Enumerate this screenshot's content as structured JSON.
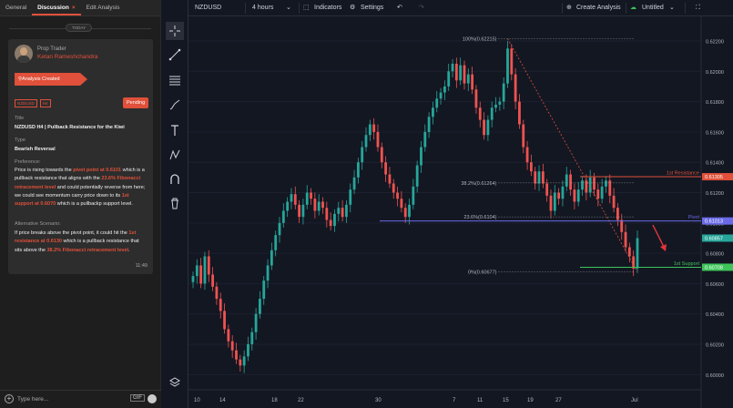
{
  "left_panel": {
    "tabs": [
      {
        "label": "General"
      },
      {
        "label": "Discussion",
        "close": "×"
      },
      {
        "label": "Edit Analysis"
      }
    ],
    "today": "TODAY",
    "card": {
      "role": "Prop Trader",
      "author": "Ketan Rameshchandra",
      "banner": "Analysis Created",
      "tags": [
        "NZDUSD",
        "H4"
      ],
      "status": "Pending",
      "title_label": "Title",
      "title": "NZDUSD H4 | Pullback Resistance for the Kiwi",
      "type_label": "Type",
      "type": "Bearish Reversal",
      "preference_label": "Preference:",
      "pref": {
        "t1": "Price is rising towards the ",
        "h1": "pivot point at 0.6101",
        "t2": " which is a pullback resistance that aligns with the ",
        "h2": "23.6% Fibonacci retracement level",
        "t3": " and could potentially reverse from here; we could see momentum carry price down to its ",
        "h3": "1st support at 0.6070",
        "t4": " which is a pullbackp support level."
      },
      "alternative_label": "Alternative Scenario:",
      "alt": {
        "t1": "If price breaks above the pivot point, it could hit the ",
        "h1": "1st resistance at 0.6130",
        "t2": " which is a pullback resistance that sits above the ",
        "h2": "38.2% Fibonacci retracement level",
        "t3": "."
      },
      "time": "11:49"
    },
    "compose": {
      "placeholder": "Type here...",
      "gif": "GIF"
    }
  },
  "toolbar": {
    "symbol": "NZDUSD",
    "interval": "4 hours",
    "indicators": "Indicators",
    "settings": "Settings",
    "create_analysis": "Create Analysis",
    "layout_name": "Untitled"
  },
  "chart_data": {
    "type": "candlestick",
    "symbol": "NZDUSD",
    "timeframe": "H4",
    "ylim": [
      0.599,
      0.6235
    ],
    "y_ticks": [
      "0.62400",
      "0.62200",
      "0.62000",
      "0.61800",
      "0.61600",
      "0.61400",
      "0.61200",
      "0.61000",
      "0.60800",
      "0.60600",
      "0.60400",
      "0.60200",
      "0.60000",
      "0.59800"
    ],
    "x_ticks": [
      "10",
      "14",
      "18",
      "22",
      "30",
      "7",
      "11",
      "15",
      "19",
      "27",
      "Jul"
    ],
    "levels": [
      {
        "name": "1st Resistance",
        "price": 0.61305,
        "label": "0.61305",
        "color": "#e0503a"
      },
      {
        "name": "Pivot",
        "price": 0.61013,
        "label": "0.61013",
        "color": "#6a6ae8"
      },
      {
        "name": "1st Support",
        "price": 0.60708,
        "label": "0.60708",
        "color": "#3ec45a"
      }
    ],
    "last_price": {
      "label": "0.60857",
      "color": "#26a69a"
    },
    "fib": [
      {
        "label": "100%(0.62215)",
        "price": 0.62215
      },
      {
        "label": "38.2%(0.61264)",
        "price": 0.61264
      },
      {
        "label": "23.6%(0.6104)",
        "price": 0.6104
      },
      {
        "label": "0%(0.60677)",
        "price": 0.60677
      }
    ],
    "closes": [
      0.6065,
      0.6072,
      0.606,
      0.6078,
      0.6066,
      0.6058,
      0.605,
      0.6042,
      0.603,
      0.6022,
      0.6016,
      0.601,
      0.6006,
      0.6012,
      0.602,
      0.6028,
      0.604,
      0.605,
      0.6062,
      0.6072,
      0.6082,
      0.6092,
      0.61,
      0.6108,
      0.6114,
      0.6119,
      0.6112,
      0.6104,
      0.6112,
      0.612,
      0.6116,
      0.6108,
      0.6114,
      0.611,
      0.6102,
      0.6098,
      0.6106,
      0.611,
      0.6104,
      0.6112,
      0.6122,
      0.613,
      0.614,
      0.615,
      0.6158,
      0.6165,
      0.616,
      0.615,
      0.614,
      0.6132,
      0.6126,
      0.612,
      0.6116,
      0.611,
      0.6104,
      0.6112,
      0.6124,
      0.6138,
      0.615,
      0.616,
      0.617,
      0.6176,
      0.6182,
      0.6186,
      0.619,
      0.62,
      0.6205,
      0.6194,
      0.6204,
      0.6192,
      0.6198,
      0.6188,
      0.6176,
      0.6168,
      0.6158,
      0.6168,
      0.6176,
      0.6178,
      0.618,
      0.6192,
      0.6215,
      0.6198,
      0.618,
      0.6165,
      0.615,
      0.614,
      0.6134,
      0.6126,
      0.6134,
      0.6126,
      0.6118,
      0.6108,
      0.612,
      0.6116,
      0.6124,
      0.6132,
      0.6122,
      0.6114,
      0.6122,
      0.6128,
      0.612,
      0.613,
      0.6122,
      0.6116,
      0.6124,
      0.6128,
      0.6118,
      0.611,
      0.6102,
      0.6094,
      0.6084,
      0.6078,
      0.607,
      0.609
    ]
  }
}
